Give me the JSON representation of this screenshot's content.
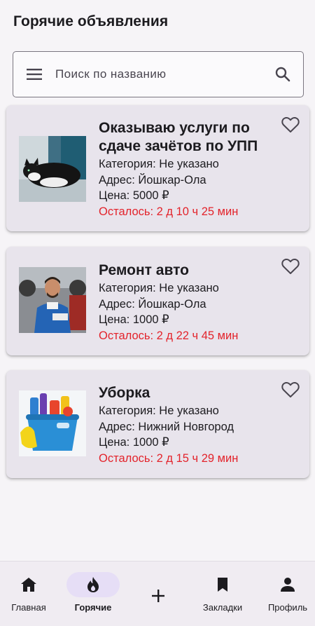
{
  "header": {
    "title": "Горячие объявления"
  },
  "search": {
    "placeholder": "Поиск по названию"
  },
  "listings": [
    {
      "title": "Оказываю услуги по сдаче зачётов по УПП",
      "category": "Категория: Не указано",
      "address": "Адрес: Йошкар-Ола",
      "price": "Цена: 5000 ₽",
      "time_left": "Осталось: 2 д 10 ч 25 мин",
      "image": "cat-photo"
    },
    {
      "title": "Ремонт авто",
      "category": "Категория: Не указано",
      "address": "Адрес: Йошкар-Ола",
      "price": "Цена: 1000 ₽",
      "time_left": "Осталось: 2 д 22 ч 45 мин",
      "image": "mechanic-photo"
    },
    {
      "title": "Уборка",
      "category": "Категория: Не указано",
      "address": "Адрес: Нижний Новгород",
      "price": "Цена: 1000 ₽",
      "time_left": "Осталось: 2 д 15 ч 29 мин",
      "image": "cleaning-supplies-photo"
    }
  ],
  "nav": {
    "home": "Главная",
    "hot": "Горячие",
    "bookmarks": "Закладки",
    "profile": "Профиль"
  },
  "colors": {
    "accent_red": "#e3232b",
    "card_bg": "#e8e4ec",
    "nav_active_pill": "#e6def6"
  }
}
